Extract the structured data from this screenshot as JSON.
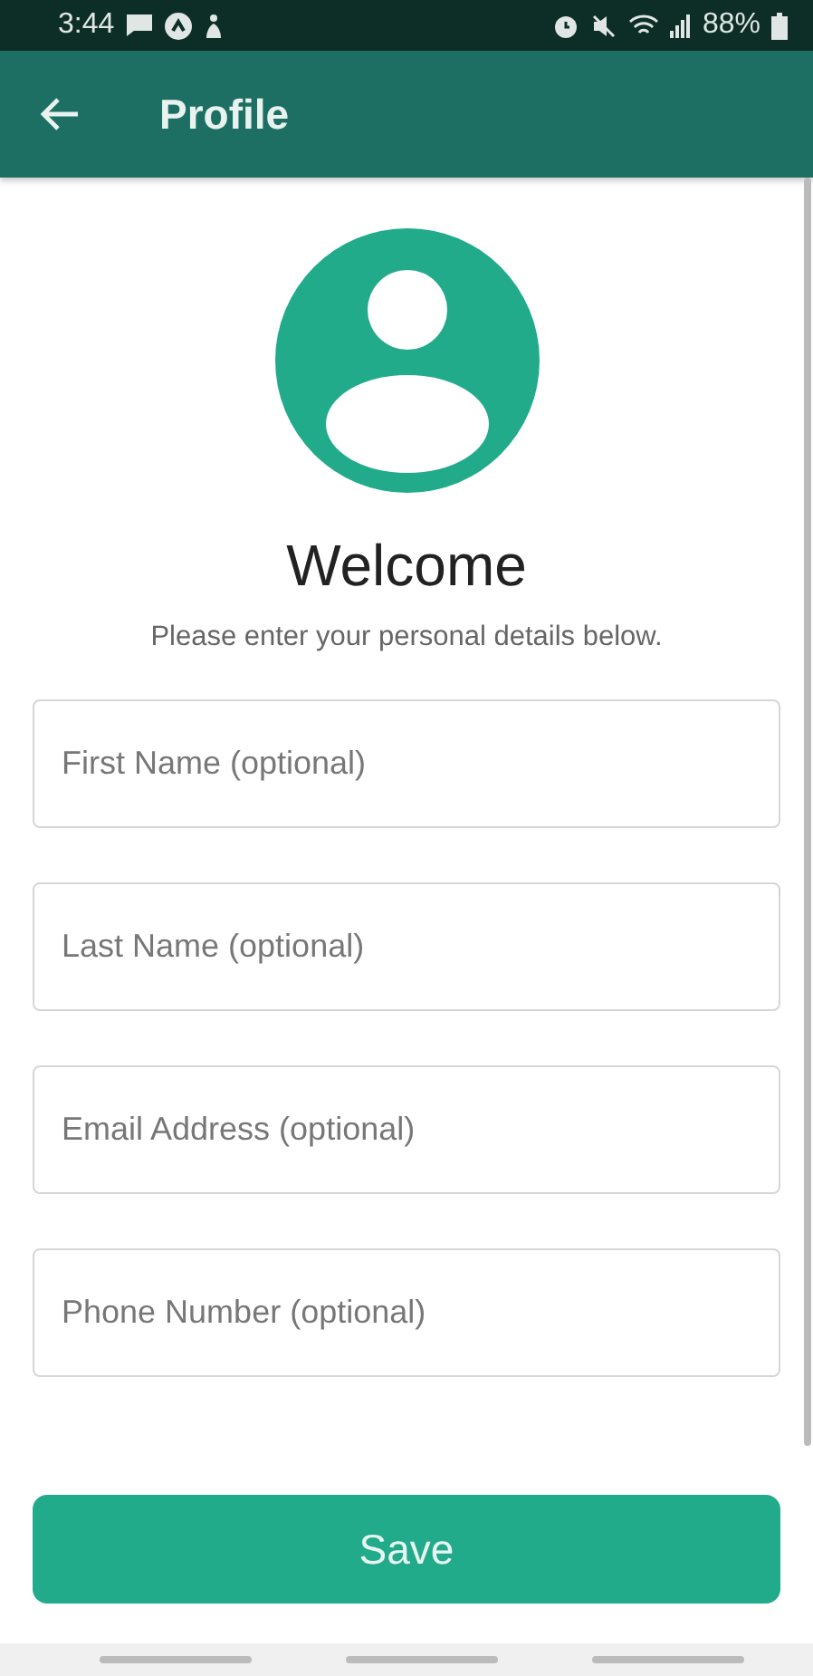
{
  "status_bar": {
    "time": "3:44",
    "battery": "88%"
  },
  "app_bar": {
    "title": "Profile"
  },
  "heading": "Welcome",
  "subtitle": "Please enter your personal details below.",
  "fields": [
    {
      "placeholder": "First Name (optional)"
    },
    {
      "placeholder": "Last Name (optional)"
    },
    {
      "placeholder": "Email Address (optional)"
    },
    {
      "placeholder": "Phone Number (optional)"
    }
  ],
  "save_button": "Save"
}
